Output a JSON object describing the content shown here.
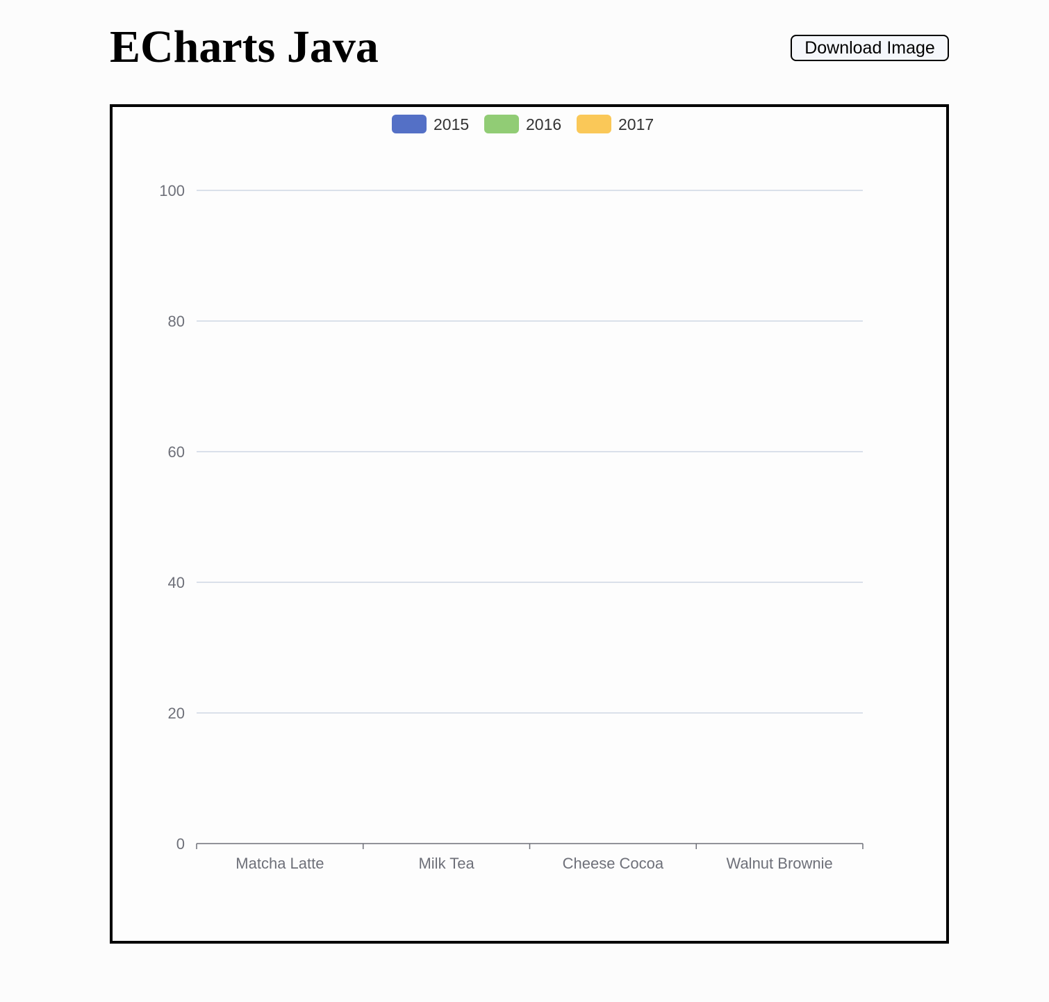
{
  "header": {
    "title": "ECharts Java",
    "download_label": "Download Image"
  },
  "chart_data": {
    "type": "bar",
    "categories": [
      "Matcha Latte",
      "Milk Tea",
      "Cheese Cocoa",
      "Walnut Brownie"
    ],
    "series": [
      {
        "name": "2015",
        "values": [
          0,
          0,
          0,
          0
        ],
        "color": "#5470c6"
      },
      {
        "name": "2016",
        "values": [
          0,
          0,
          0,
          0
        ],
        "color": "#91cc75"
      },
      {
        "name": "2017",
        "values": [
          0,
          0,
          0,
          0
        ],
        "color": "#fac858"
      }
    ],
    "ylim": [
      0,
      100
    ],
    "yticks": [
      "0",
      "20",
      "40",
      "60",
      "80",
      "100"
    ],
    "legend_position": "top-center",
    "grid": true,
    "axis_color": "#6e7079",
    "grid_color": "#b8c4d6",
    "text_color": "#333333"
  }
}
